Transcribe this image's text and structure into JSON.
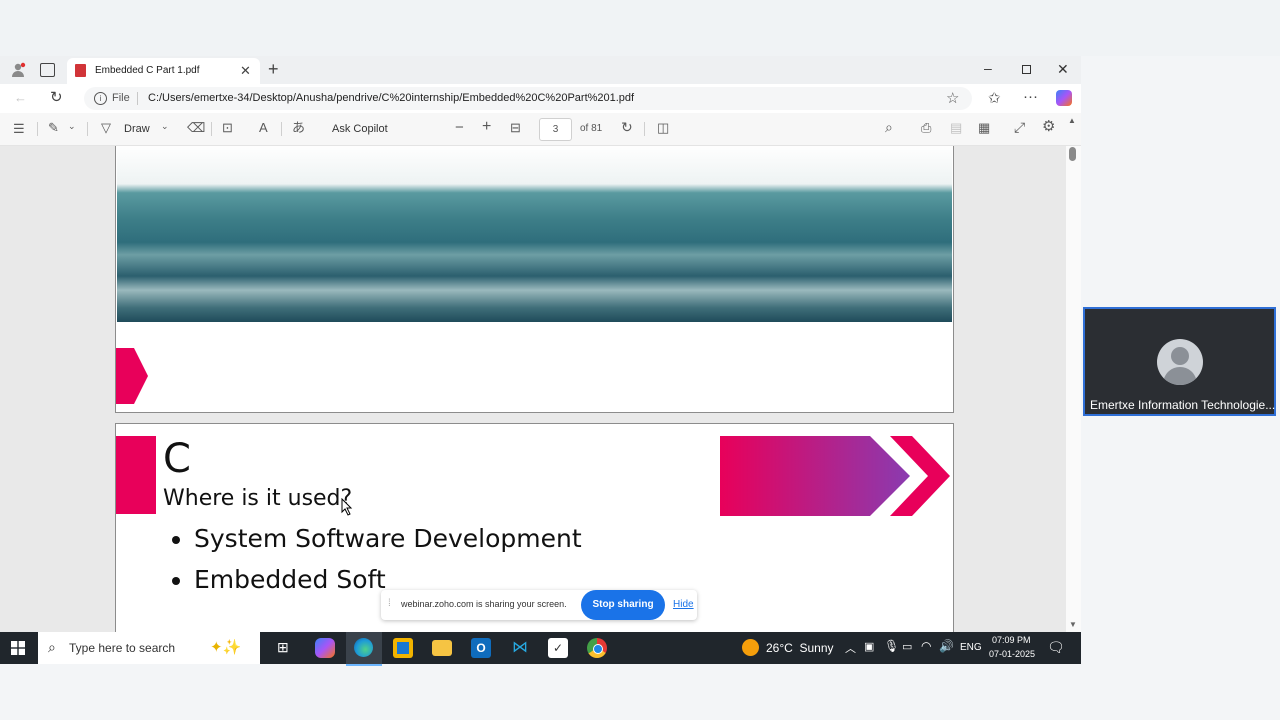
{
  "tab": {
    "title": "Embedded C Part 1.pdf"
  },
  "address": {
    "file_label": "File",
    "url": "C:/Users/emertxe-34/Desktop/Anusha/pendrive/C%20internship/Embedded%20C%20Part%201.pdf"
  },
  "pdf_toolbar": {
    "draw_label": "Draw",
    "copilot_label": "Ask Copilot",
    "page_current": "3",
    "page_total": "of 81"
  },
  "slide": {
    "title": "C",
    "subtitle": "Where is it used?",
    "bullets": [
      "System Software Development",
      "Embedded Soft"
    ]
  },
  "share_banner": {
    "message": "webinar.zoho.com is sharing your screen.",
    "stop_label": "Stop sharing",
    "hide_label": "Hide"
  },
  "participant": {
    "name": "Emertxe Information Technologie..."
  },
  "taskbar": {
    "search_placeholder": "Type here to search",
    "weather": "26°C  Sunny",
    "language": "ENG",
    "time": "07:09 PM",
    "date": "07-01-2025"
  },
  "colors": {
    "accent_pink": "#e8005a",
    "purple": "#8a3bb0",
    "share_blue": "#1a73e8",
    "taskbar": "#20262c"
  }
}
